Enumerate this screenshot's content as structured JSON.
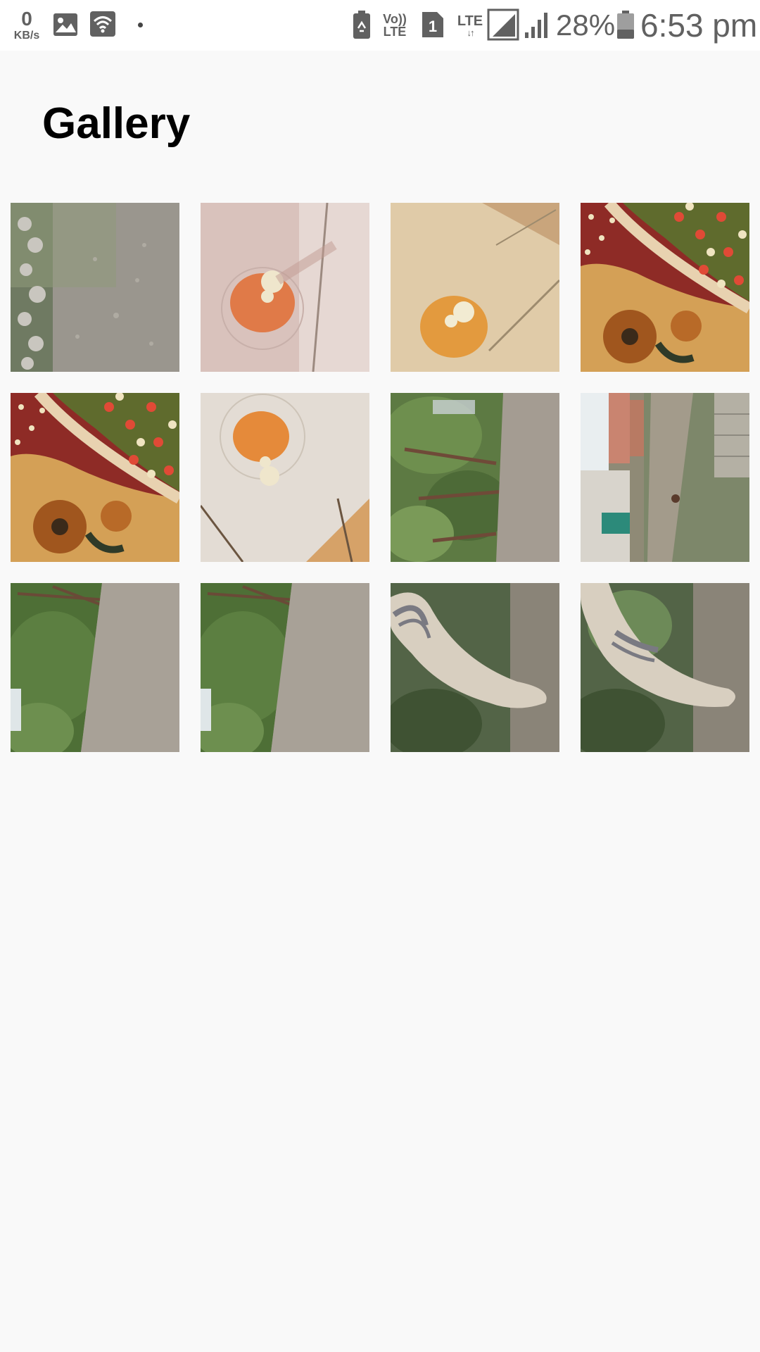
{
  "status_bar": {
    "net_speed_value": "0",
    "net_speed_unit": "KB/s",
    "volte_line1": "Vo))",
    "volte_line2": "LTE",
    "sim_number": "1",
    "lte_label": "LTE",
    "lte_arrows": "↓↑",
    "battery_percent": "28%",
    "time": "6:53 pm",
    "icons": [
      "image-notification-icon",
      "wifi-icon",
      "battery-saver-icon",
      "volte-icon",
      "sim-1-icon",
      "lte-data-icon",
      "signal-strength-icon",
      "signal-strength-2-icon",
      "battery-icon"
    ]
  },
  "header": {
    "title": "Gallery"
  },
  "gallery": {
    "photos": [
      {
        "subject": "gravel-path-rocks"
      },
      {
        "subject": "ceiling-fan-light"
      },
      {
        "subject": "ceiling-fan-light-warm"
      },
      {
        "subject": "floral-blanket"
      },
      {
        "subject": "floral-blanket"
      },
      {
        "subject": "ceiling-light"
      },
      {
        "subject": "trees-dirt-path"
      },
      {
        "subject": "street-buildings"
      },
      {
        "subject": "trees-dirt-road"
      },
      {
        "subject": "trees-dirt-road"
      },
      {
        "subject": "cloth-towel"
      },
      {
        "subject": "cloth-towel"
      }
    ]
  }
}
